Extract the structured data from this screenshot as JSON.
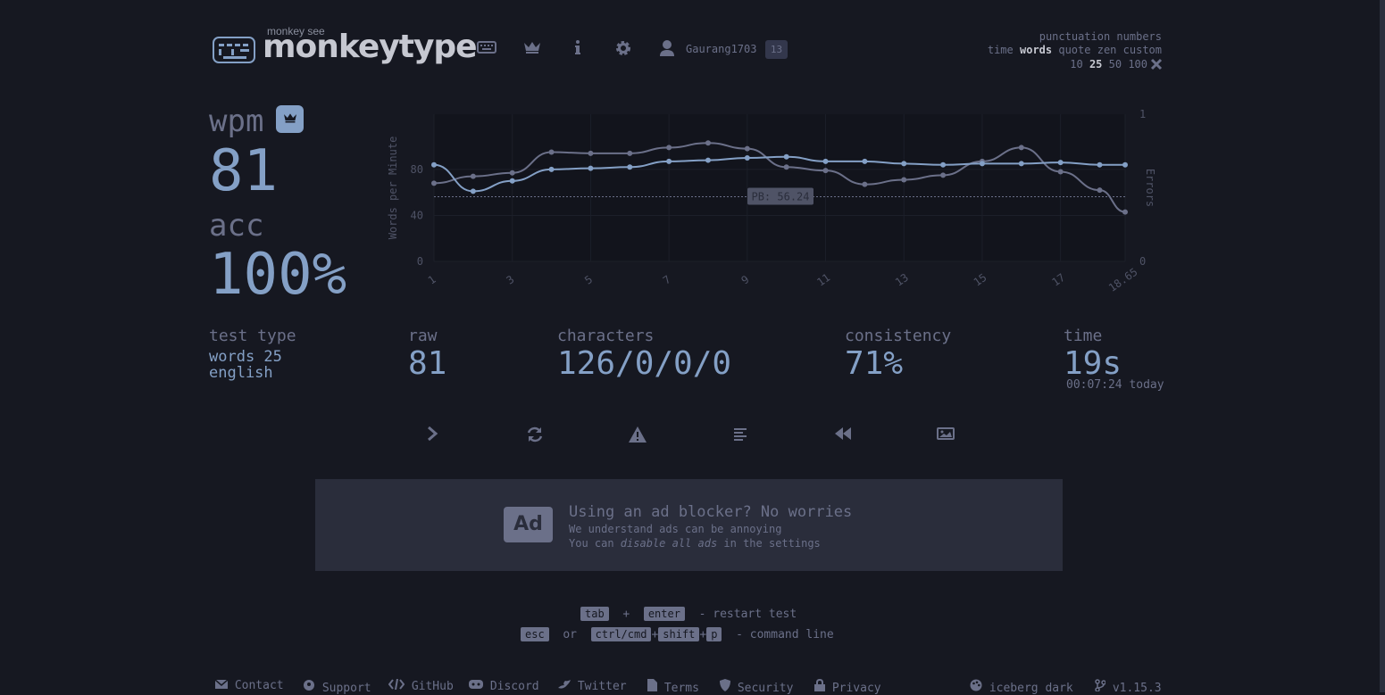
{
  "header": {
    "logo_subtitle": "monkey see",
    "logo_title": "monkeytype",
    "nav_icons": [
      "keyboard-icon",
      "crown-icon",
      "info-icon",
      "settings-icon",
      "user-icon"
    ],
    "username": "Gaurang1703",
    "level": "13"
  },
  "config": {
    "modifiers": "punctuation numbers",
    "modes": [
      "time",
      "words",
      "quote",
      "zen",
      "custom"
    ],
    "active_mode": "words",
    "counts": [
      "10",
      "25",
      "50",
      "100"
    ],
    "active_count": "25"
  },
  "result": {
    "wpm_label": "wpm",
    "wpm": "81",
    "acc_label": "acc",
    "acc": "100%",
    "test_type_label": "test type",
    "test_type_line1": "words 25",
    "test_type_line2": "english",
    "raw_label": "raw",
    "raw": "81",
    "characters_label": "characters",
    "characters": "126/0/0/0",
    "consistency_label": "consistency",
    "consistency": "71%",
    "time_label": "time",
    "time": "19s",
    "time_sub": "00:07:24 today"
  },
  "chart_data": {
    "type": "line",
    "x": [
      1,
      2,
      3,
      4,
      5,
      6,
      7,
      8,
      9,
      10,
      11,
      12,
      13,
      14,
      15,
      16,
      17,
      18,
      18.65
    ],
    "x_tick_labels": [
      "1",
      "3",
      "5",
      "7",
      "9",
      "11",
      "13",
      "15",
      "17",
      "18.65"
    ],
    "ylabel": "Words per Minute",
    "y2label": "Errors",
    "ylim": [
      0,
      128
    ],
    "y_ticks": [
      "0",
      "40",
      "80"
    ],
    "y2_ticks": [
      "0",
      "1"
    ],
    "pb_label": "PB: 56.24",
    "pb_value": 56.24,
    "series": [
      {
        "color": "#84a0c6",
        "values": [
          84,
          61,
          70,
          80,
          81,
          82,
          87,
          88,
          90,
          91,
          87,
          87,
          85,
          84,
          85,
          85,
          86,
          84,
          84
        ]
      },
      {
        "color": "#6b7089",
        "values": [
          68,
          74,
          77,
          95,
          94,
          94,
          99,
          103,
          98,
          82,
          79,
          67,
          71,
          75,
          87,
          99,
          78,
          62,
          43
        ]
      }
    ],
    "colors": {
      "accent": "#84a0c6",
      "sub": "#6b7089",
      "bg": "#161821"
    }
  },
  "actions": [
    {
      "icon": "next-test-icon"
    },
    {
      "icon": "restart-icon"
    },
    {
      "icon": "warning-icon"
    },
    {
      "icon": "words-history-icon"
    },
    {
      "icon": "replay-icon"
    },
    {
      "icon": "screenshot-icon"
    }
  ],
  "ad": {
    "badge": "Ad",
    "title": "Using an ad blocker? No worries",
    "line1": "We understand ads can be annoying",
    "line2_prefix": "You can ",
    "line2_em": "disable all ads",
    "line2_suffix": " in the settings"
  },
  "hints": {
    "k_tab": "tab",
    "plus": "+",
    "k_enter": "enter",
    "restart": "- restart test",
    "k_esc": "esc",
    "or": "or",
    "k_ctrl": "ctrl/cmd",
    "k_shift": "shift",
    "k_p": "p",
    "cmdline": "- command line"
  },
  "footer": {
    "contact": "Contact",
    "support": "Support",
    "github": "GitHub",
    "discord": "Discord",
    "twitter": "Twitter",
    "terms": "Terms",
    "security": "Security",
    "privacy": "Privacy",
    "theme": "iceberg dark",
    "version": "v1.15.3"
  }
}
